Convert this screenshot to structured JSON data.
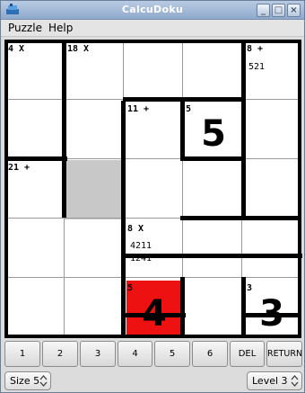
{
  "window": {
    "title": "CalcuDoku"
  },
  "menu": [
    "Puzzle",
    "Help"
  ],
  "board": {
    "clues": [
      {
        "cell": "r1c1",
        "text": "4 X"
      },
      {
        "cell": "r1c2",
        "text": "18 X"
      },
      {
        "cell": "r1c5",
        "text": "8 +"
      },
      {
        "cell": "r2c3",
        "text": "11 +"
      },
      {
        "cell": "r2c4",
        "text": "5"
      },
      {
        "cell": "r3c1",
        "text": "21 +"
      },
      {
        "cell": "r4c3",
        "text": "8 X"
      },
      {
        "cell": "r5c3",
        "text": "5"
      },
      {
        "cell": "r5c5",
        "text": "3"
      }
    ],
    "notes": {
      "r1c5": "521",
      "r4c3_line1": "4211",
      "r4c3_line2": "1241"
    },
    "values": {
      "r2c4": "5",
      "r5c3": "4",
      "r5c5": "3"
    },
    "highlight": {
      "selected_cell": "r3c2",
      "error_cell": "r5c3"
    },
    "colors": {
      "selected": "#c8c8c8",
      "error": "#ee1111",
      "cage_border": "#000000",
      "grid_line": "#9a9a9a"
    }
  },
  "number_buttons": [
    "1",
    "2",
    "3",
    "4",
    "5",
    "6",
    "DEL",
    "RETURN"
  ],
  "size_select": "Size 5",
  "level_select": "Level 3"
}
